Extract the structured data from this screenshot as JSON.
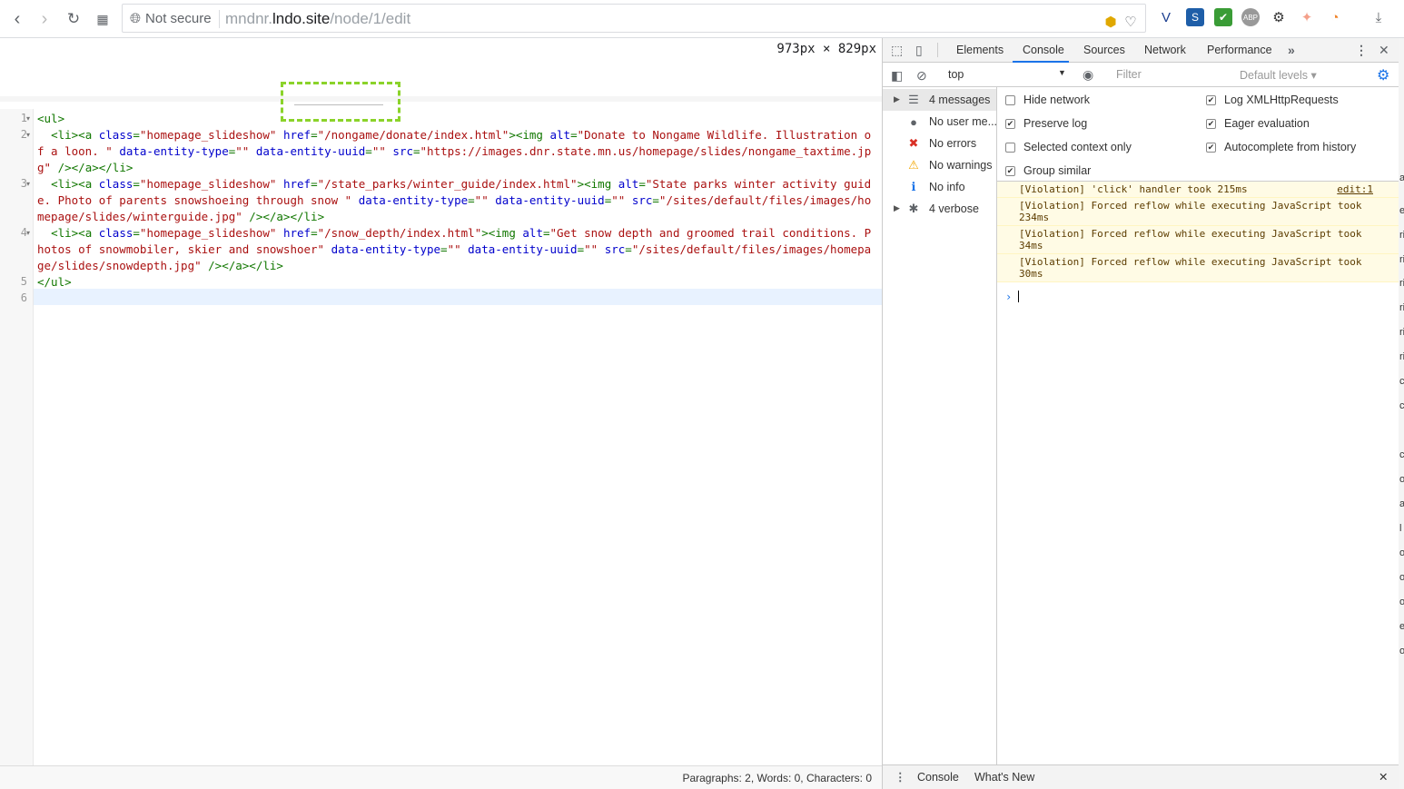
{
  "browser": {
    "security_label": "Not secure",
    "url_host_prefix": "mndnr.",
    "url_host": "lndo.site",
    "url_path": "/node/1/edit"
  },
  "editor": {
    "dimensions": "973px × 829px",
    "line_numbers": [
      "1",
      "2",
      "3",
      "4",
      "5",
      "6"
    ],
    "lines": [
      [
        {
          "c": "t",
          "v": "<ul>"
        }
      ],
      [
        {
          "c": "t",
          "v": "  <li><a "
        },
        {
          "c": "a",
          "v": "class"
        },
        {
          "c": "t",
          "v": "="
        },
        {
          "c": "s",
          "v": "\"homepage_slideshow\""
        },
        {
          "c": "t",
          "v": " "
        },
        {
          "c": "a",
          "v": "href"
        },
        {
          "c": "t",
          "v": "="
        },
        {
          "c": "s",
          "v": "\"/nongame/donate/index.html\""
        },
        {
          "c": "t",
          "v": "><img "
        },
        {
          "c": "a",
          "v": "alt"
        },
        {
          "c": "t",
          "v": "="
        },
        {
          "c": "s",
          "v": "\"Donate to Nongame Wildlife. Illustration of a loon. \""
        },
        {
          "c": "t",
          "v": " "
        },
        {
          "c": "a",
          "v": "data-entity-type"
        },
        {
          "c": "t",
          "v": "="
        },
        {
          "c": "s",
          "v": "\"\""
        },
        {
          "c": "t",
          "v": " "
        },
        {
          "c": "a",
          "v": "data-entity-uuid"
        },
        {
          "c": "t",
          "v": "="
        },
        {
          "c": "s",
          "v": "\"\""
        },
        {
          "c": "t",
          "v": " "
        },
        {
          "c": "a",
          "v": "src"
        },
        {
          "c": "t",
          "v": "="
        },
        {
          "c": "s",
          "v": "\"https://images.dnr.state.mn.us/homepage/slides/nongame_taxtime.jpg\""
        },
        {
          "c": "t",
          "v": " /></a></li>"
        }
      ],
      [
        {
          "c": "t",
          "v": "  <li><a "
        },
        {
          "c": "a",
          "v": "class"
        },
        {
          "c": "t",
          "v": "="
        },
        {
          "c": "s",
          "v": "\"homepage_slideshow\""
        },
        {
          "c": "t",
          "v": " "
        },
        {
          "c": "a",
          "v": "href"
        },
        {
          "c": "t",
          "v": "="
        },
        {
          "c": "s",
          "v": "\"/state_parks/winter_guide/index.html\""
        },
        {
          "c": "t",
          "v": "><img "
        },
        {
          "c": "a",
          "v": "alt"
        },
        {
          "c": "t",
          "v": "="
        },
        {
          "c": "s",
          "v": "\"State parks winter activity guide. Photo of parents snowshoeing through snow \""
        },
        {
          "c": "t",
          "v": " "
        },
        {
          "c": "a",
          "v": "data-entity-type"
        },
        {
          "c": "t",
          "v": "="
        },
        {
          "c": "s",
          "v": "\"\""
        },
        {
          "c": "t",
          "v": " "
        },
        {
          "c": "a",
          "v": "data-entity-uuid"
        },
        {
          "c": "t",
          "v": "="
        },
        {
          "c": "s",
          "v": "\"\""
        },
        {
          "c": "t",
          "v": " "
        },
        {
          "c": "a",
          "v": "src"
        },
        {
          "c": "t",
          "v": "="
        },
        {
          "c": "s",
          "v": "\"/sites/default/files/images/homepage/slides/winterguide.jpg\""
        },
        {
          "c": "t",
          "v": " /></a></li>"
        }
      ],
      [
        {
          "c": "t",
          "v": "  <li><a "
        },
        {
          "c": "a",
          "v": "class"
        },
        {
          "c": "t",
          "v": "="
        },
        {
          "c": "s",
          "v": "\"homepage_slideshow\""
        },
        {
          "c": "t",
          "v": " "
        },
        {
          "c": "a",
          "v": "href"
        },
        {
          "c": "t",
          "v": "="
        },
        {
          "c": "s",
          "v": "\"/snow_depth/index.html\""
        },
        {
          "c": "t",
          "v": "><img "
        },
        {
          "c": "a",
          "v": "alt"
        },
        {
          "c": "t",
          "v": "="
        },
        {
          "c": "s",
          "v": "\"Get snow depth and groomed trail conditions. Photos of snowmobiler, skier and snowshoer\""
        },
        {
          "c": "t",
          "v": " "
        },
        {
          "c": "a",
          "v": "data-entity-type"
        },
        {
          "c": "t",
          "v": "="
        },
        {
          "c": "s",
          "v": "\"\""
        },
        {
          "c": "t",
          "v": " "
        },
        {
          "c": "a",
          "v": "data-entity-uuid"
        },
        {
          "c": "t",
          "v": "="
        },
        {
          "c": "s",
          "v": "\"\""
        },
        {
          "c": "t",
          "v": " "
        },
        {
          "c": "a",
          "v": "src"
        },
        {
          "c": "t",
          "v": "="
        },
        {
          "c": "s",
          "v": "\"/sites/default/files/images/homepage/slides/snowdepth.jpg\""
        },
        {
          "c": "t",
          "v": " /></a></li>"
        }
      ],
      [
        {
          "c": "t",
          "v": "</ul>"
        }
      ],
      [
        {
          "c": "t",
          "v": ""
        }
      ]
    ],
    "status": "Paragraphs: 2, Words: 0, Characters: 0"
  },
  "devtools": {
    "tabs": [
      "Elements",
      "Console",
      "Sources",
      "Network",
      "Performance"
    ],
    "active_tab": "Console",
    "context": "top",
    "filter_placeholder": "Filter",
    "levels": "Default levels ▾",
    "sidebar": [
      {
        "label": "4 messages",
        "icon": "list-icon",
        "arrow": true,
        "selected": true
      },
      {
        "label": "No user me...",
        "icon": "user-icon",
        "arrow": false
      },
      {
        "label": "No errors",
        "icon": "error-icon",
        "arrow": false
      },
      {
        "label": "No warnings",
        "icon": "warning-icon",
        "arrow": false
      },
      {
        "label": "No info",
        "icon": "info-icon",
        "arrow": false
      },
      {
        "label": "4 verbose",
        "icon": "bug-icon",
        "arrow": true
      }
    ],
    "options": {
      "hide_network": "Hide network",
      "preserve_log": "Preserve log",
      "selected_context": "Selected context only",
      "group_similar": "Group similar",
      "log_xhr": "Log XMLHttpRequests",
      "eager_eval": "Eager evaluation",
      "autocomplete": "Autocomplete from history"
    },
    "messages": [
      {
        "text": "[Violation] 'click' handler took 215ms",
        "src": "edit:1"
      },
      {
        "text": "[Violation] Forced reflow while executing JavaScript took 234ms",
        "src": ""
      },
      {
        "text": "[Violation] Forced reflow while executing JavaScript took 34ms",
        "src": ""
      },
      {
        "text": "[Violation] Forced reflow while executing JavaScript took 30ms",
        "src": ""
      }
    ],
    "drawer_tabs": [
      "Console",
      "What's New"
    ]
  },
  "right_strip_marks": [
    "a",
    "e",
    "ri",
    "ri",
    "ri",
    "ri",
    "ri",
    "ri",
    "c",
    "c",
    "c",
    "o",
    "a",
    "l",
    "o",
    "o",
    "o",
    "e",
    "o"
  ],
  "colors": {
    "accent": "#1a73e8",
    "violation_bg": "#fffbe5",
    "green_box": "#8bd32a"
  }
}
